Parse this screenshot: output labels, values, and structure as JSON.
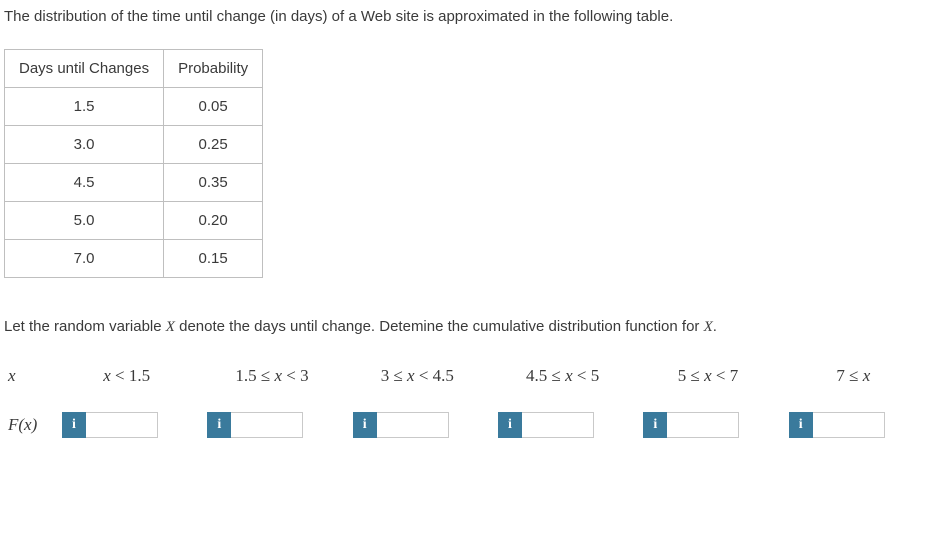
{
  "intro": "The distribution of the time until change (in days) of a Web site is approximated in the following table.",
  "table": {
    "headers": [
      "Days until Changes",
      "Probability"
    ],
    "rows": [
      {
        "days": "1.5",
        "prob": "0.05"
      },
      {
        "days": "3.0",
        "prob": "0.25"
      },
      {
        "days": "4.5",
        "prob": "0.35"
      },
      {
        "days": "5.0",
        "prob": "0.20"
      },
      {
        "days": "7.0",
        "prob": "0.15"
      }
    ]
  },
  "prompt2_pre": "Let the random variable ",
  "prompt2_var": "X",
  "prompt2_post": " denote the days until change. Detemine the cumulative distribution function for ",
  "prompt2_var2": "X",
  "prompt2_end": ".",
  "row_labels": {
    "x": "x",
    "fx": "F(x)"
  },
  "col_heads": {
    "c1": {
      "pre": "",
      "var": "x",
      "post": " < 1.5"
    },
    "c2": {
      "pre": "1.5 ≤ ",
      "var": "x",
      "post": " < 3"
    },
    "c3": {
      "pre": "3 ≤ ",
      "var": "x",
      "post": " < 4.5"
    },
    "c4": {
      "pre": "4.5 ≤ ",
      "var": "x",
      "post": " < 5"
    },
    "c5": {
      "pre": "5 ≤ ",
      "var": "x",
      "post": " < 7"
    },
    "c6": {
      "pre": "7 ≤ ",
      "var": "x",
      "post": ""
    }
  },
  "info_glyph": "i",
  "inputs": {
    "v1": "",
    "v2": "",
    "v3": "",
    "v4": "",
    "v5": "",
    "v6": ""
  }
}
